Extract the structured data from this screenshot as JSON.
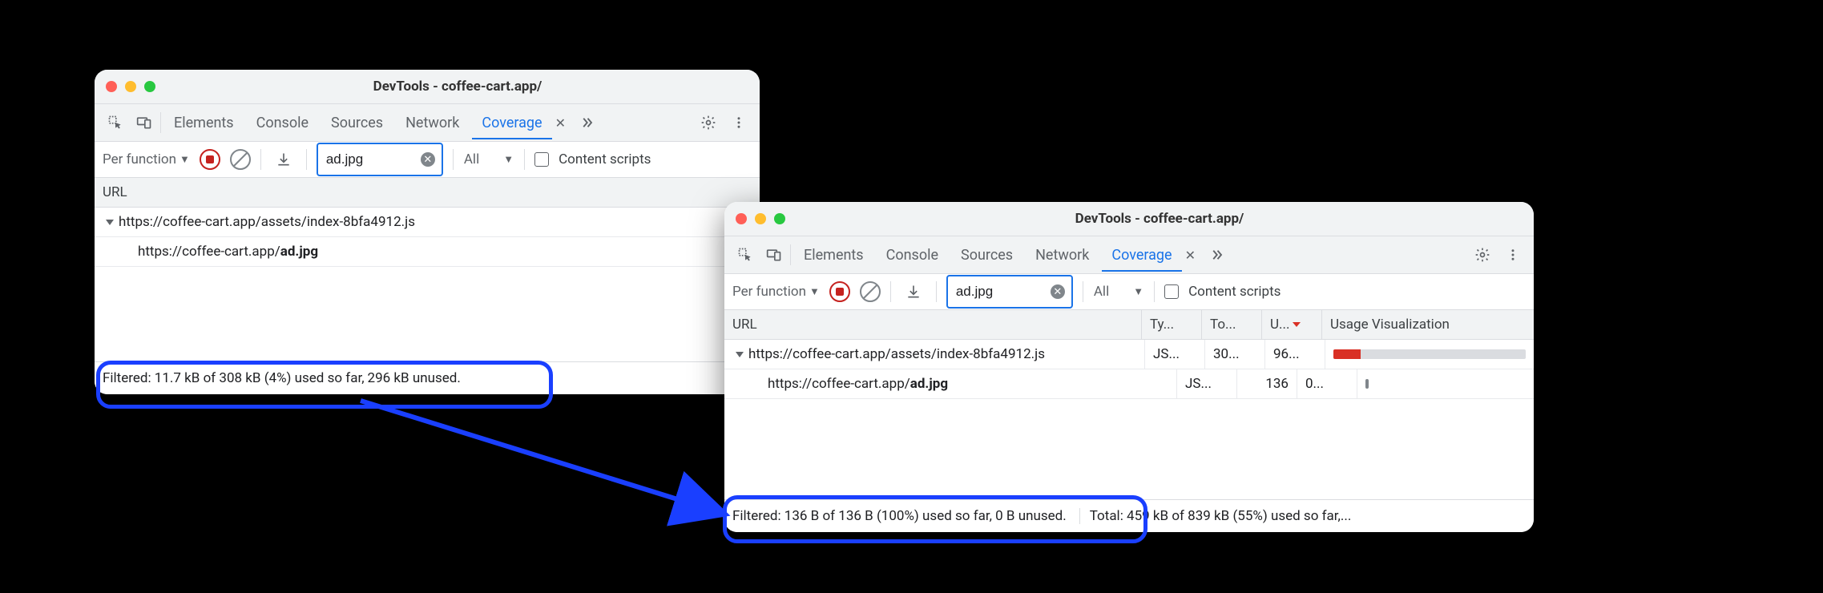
{
  "colors": {
    "accent": "#1a73e8",
    "highlight": "#1a3fff",
    "unused_bar": "#dadce0",
    "used_bar": "#d93025"
  },
  "tabs": {
    "elements": "Elements",
    "console": "Console",
    "sources": "Sources",
    "network": "Network",
    "coverage": "Coverage"
  },
  "toolbar": {
    "per_function": "Per function",
    "filter_value": "ad.jpg",
    "all": "All",
    "content_scripts": "Content scripts"
  },
  "columns": {
    "url": "URL",
    "type": "Ty...",
    "total": "To...",
    "unused": "U...",
    "usage_viz": "Usage Visualization"
  },
  "urls": {
    "parent": "https://coffee-cart.app/assets/index-8bfa4912.js",
    "child_prefix": "https://coffee-cart.app/",
    "child_bold": "ad.jpg"
  },
  "window_a": {
    "title": "DevTools - coffee-cart.app/",
    "status_filtered": "Filtered: 11.7 kB of 308 kB (4%) used so far,",
    "status_unused": "296 kB unused."
  },
  "window_b": {
    "title": "DevTools - coffee-cart.app/",
    "rows": [
      {
        "type": "JS...",
        "total": "30...",
        "unused": "96...",
        "used_pct": 14
      },
      {
        "type": "JS...",
        "total": "136",
        "unused": "0...",
        "used_pct": 2
      }
    ],
    "status_filtered": "Filtered: 136 B of 136 B (100%) used so far, 0 B unused.",
    "status_total": "Total: 459 kB of 839 kB (55%) used so far,..."
  }
}
